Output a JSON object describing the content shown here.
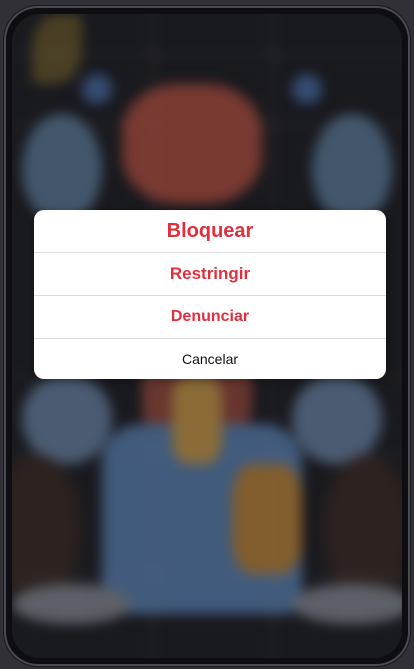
{
  "colors": {
    "destructive": "#e0303e",
    "cancel": "#111111",
    "sheet_background": "#ffffff",
    "divider": "#dcdcdc"
  },
  "action_sheet": {
    "block_label": "Bloquear",
    "restrict_label": "Restringir",
    "report_label": "Denunciar",
    "cancel_label": "Cancelar"
  }
}
